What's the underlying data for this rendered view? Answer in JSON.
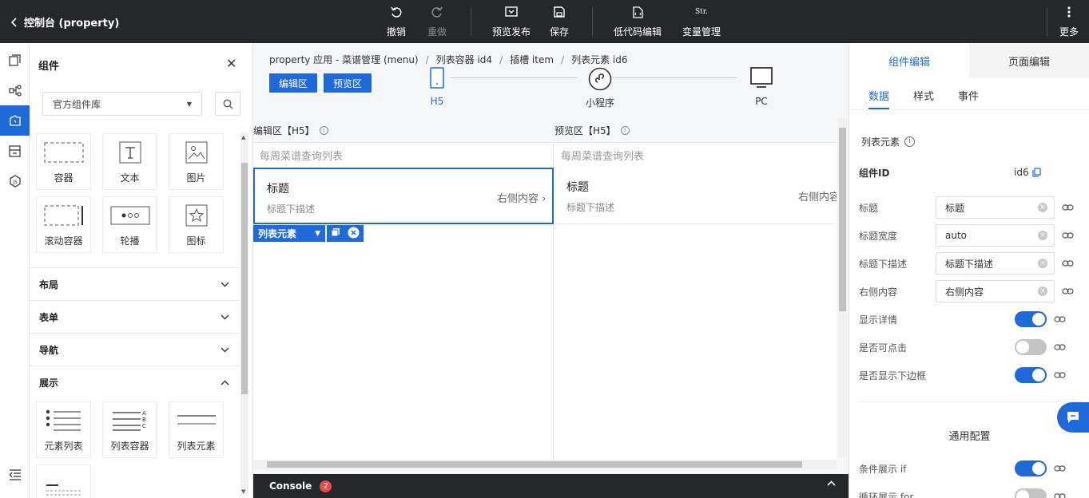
{
  "topbar": {
    "back_label": "控制台 (property)",
    "undo": "撤销",
    "redo": "重做",
    "preview_publish": "预览发布",
    "save": "保存",
    "lowcode": "低代码编辑",
    "variables": "变量管理",
    "variables_icon_text": "Str.",
    "more": "更多"
  },
  "left_panel": {
    "title": "组件",
    "library_select": "官方组件库",
    "top_components": [
      "容器",
      "文本",
      "图片",
      "滚动容器",
      "轮播",
      "图标"
    ],
    "sections": [
      "布局",
      "表单",
      "导航",
      "展示"
    ],
    "display_components": [
      "元素列表",
      "列表容器",
      "列表元素"
    ]
  },
  "center": {
    "breadcrumb": [
      "property 应用 - 菜谱管理 (menu)",
      "列表容器 id4",
      "插槽 item",
      "列表元素 id6"
    ],
    "edit_btn": "编辑区",
    "preview_btn": "预览区",
    "devices": [
      "H5",
      "小程序",
      "PC"
    ],
    "edit_zone_title": "编辑区【H5】",
    "preview_zone_title": "预览区【H5】",
    "list_header": "每周菜谱查询列表",
    "item_title": "标题",
    "item_desc": "标题下描述",
    "item_right": "右侧内容",
    "selected_tag": "列表元素",
    "console_label": "Console",
    "console_count": "2"
  },
  "right_panel": {
    "tabs": [
      "组件编辑",
      "页面编辑"
    ],
    "subtabs": [
      "数据",
      "样式",
      "事件"
    ],
    "section_title": "列表元素",
    "component_id_label": "组件ID",
    "component_id": "id6",
    "fields": [
      {
        "label": "标题",
        "value": "标题"
      },
      {
        "label": "标题宽度",
        "value": "auto"
      },
      {
        "label": "标题下描述",
        "value": "标题下描述"
      },
      {
        "label": "右侧内容",
        "value": "右侧内容"
      }
    ],
    "toggles": [
      {
        "label": "显示详情",
        "on": true
      },
      {
        "label": "是否可点击",
        "on": false
      },
      {
        "label": "是否显示下边框",
        "on": true
      }
    ],
    "general_title": "通用配置",
    "general_toggles": [
      {
        "label": "条件展示 if",
        "on": true
      },
      {
        "label": "循环展示 for",
        "on": false
      }
    ]
  },
  "colors": {
    "accent": "#1f6ad8",
    "topbar": "#26272b"
  }
}
